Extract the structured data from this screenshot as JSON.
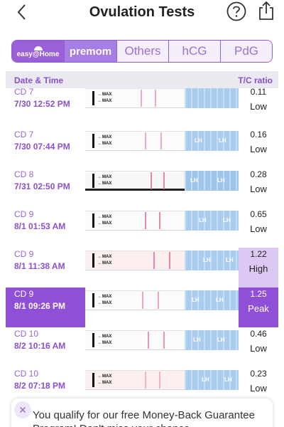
{
  "header": {
    "title": "Ovulation Tests",
    "back_icon": "chevron-left-icon",
    "help_icon": "question-circle-icon",
    "share_icon": "share-icon"
  },
  "tabs": [
    {
      "label": "easy@Home",
      "kind": "logo"
    },
    {
      "label": "premom",
      "kind": "logo"
    },
    {
      "label": "Others"
    },
    {
      "label": "hCG"
    },
    {
      "label": "PdG"
    }
  ],
  "columns": {
    "date_time": "Date & Time",
    "tc_ratio": "T/C ratio"
  },
  "strip_text": {
    "max": "←MAX",
    "lh": "LH"
  },
  "rows": [
    {
      "cd": "CD 7",
      "datetime": "7/30  12:52 PM",
      "ratio": "0.11",
      "level": "Low"
    },
    {
      "cd": "CD 7",
      "datetime": "7/30  07:44 PM",
      "ratio": "0.16",
      "level": "Low"
    },
    {
      "cd": "CD 8",
      "datetime": "7/31  02:50 PM",
      "ratio": "0.28",
      "level": "Low"
    },
    {
      "cd": "CD 9",
      "datetime": "8/1  01:53 AM",
      "ratio": "0.65",
      "level": "Low"
    },
    {
      "cd": "CD 9",
      "datetime": "8/1  11:38 AM",
      "ratio": "1.22",
      "level": "High"
    },
    {
      "cd": "CD 9",
      "datetime": "8/1  09:26 PM",
      "ratio": "1.25",
      "level": "Peak"
    },
    {
      "cd": "CD 10",
      "datetime": "8/2  10:16 AM",
      "ratio": "0.46",
      "level": "Low"
    },
    {
      "cd": "CD 10",
      "datetime": "8/2  07:18 PM",
      "ratio": "0.23",
      "level": "Low"
    }
  ],
  "promo": {
    "text": "You qualify for our free Money-Back Guarantee Program! Don't miss your chance",
    "close_icon": "close-icon"
  },
  "colors": {
    "accent": "#8f4fd6",
    "high": "#ddc8f4",
    "strip_blue": "#a9cdee"
  }
}
